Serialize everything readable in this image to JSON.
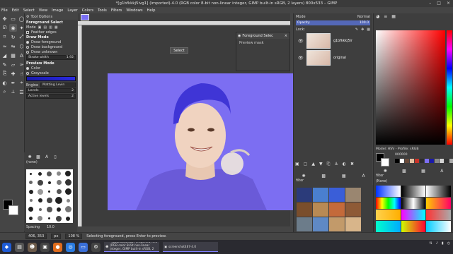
{
  "window": {
    "title": "*[g1bfkkkj5ivg1] (imported)-4.0 (RGB color 8-bit non-linear integer, GIMP built-in sRGB, 2 layers) 800x533 – GIMP",
    "controls": [
      "–",
      "□",
      "×"
    ]
  },
  "menubar": {
    "items": [
      "File",
      "Edit",
      "Select",
      "View",
      "Image",
      "Layer",
      "Colors",
      "Tools",
      "Filters",
      "Windows",
      "Help"
    ]
  },
  "tool_options": {
    "tab_label": "Tool Options",
    "tool_name": "Foreground Select",
    "mode_label": "Mode",
    "feather_label": "Feather edges",
    "draw_mode_label": "Draw Mode",
    "draw_modes": [
      "Draw foreground",
      "Draw background",
      "Draw unknown"
    ],
    "stroke_width_label": "Stroke width",
    "stroke_width_value": "1.92",
    "preview_mode_label": "Preview Mode",
    "preview_modes": [
      "Color",
      "Grayscale"
    ],
    "engine_label": "Engine",
    "engine_value": "Matting Levin",
    "levels_label": "Levels",
    "levels_value": "2",
    "active_levels_label": "Active levels",
    "active_levels_value": "2"
  },
  "brushes": {
    "filter_label": "(none)",
    "spacing_label": "Spacing",
    "spacing_value": "10.0"
  },
  "fg_dialog": {
    "title": "Foreground Selec",
    "preview_label": "Preview mask",
    "select_button": "Select"
  },
  "status": {
    "coords": "406, 353",
    "unit": "px",
    "zoom": "108 %",
    "message": "Selecting foreground, press Enter to preview."
  },
  "layers": {
    "mode_label": "Mode",
    "mode_value": "Normal",
    "opacity_label": "Opacity",
    "opacity_value": "100.0",
    "lock_label": "Lock:",
    "items": [
      {
        "name": "g1bfkkkj5ir"
      },
      {
        "name": "original"
      }
    ],
    "filter_label": "filter"
  },
  "colors": {
    "model_label": "Model: HSV - Profile: sRGB",
    "hex_label": "HTML notation",
    "hex_value": "000000",
    "filter_label": "filter",
    "gradients_filter": "(None)"
  },
  "taskbar": {
    "windows": [
      {
        "label": "*[g1bfkkkj5ivg1] (imported)-4.0 (RGB color 8-bit non-linear integer, GIMP built-in sRGB, 2 la..."
      },
      {
        "label": "screenshot4E7-4.0"
      }
    ]
  },
  "palette": {
    "photo_bg": "#7c6ef2",
    "accent": "#5468b8"
  }
}
